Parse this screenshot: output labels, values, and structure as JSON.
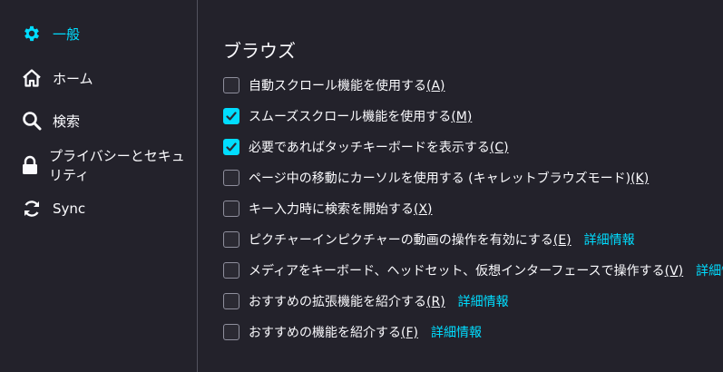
{
  "sidebar": {
    "items": [
      {
        "label": "一般",
        "icon": "gear-icon",
        "selected": true
      },
      {
        "label": "ホーム",
        "icon": "home-icon"
      },
      {
        "label": "検索",
        "icon": "search-icon"
      },
      {
        "label": "プライバシーとセキュリティ",
        "icon": "lock-icon"
      },
      {
        "label": "Sync",
        "icon": "sync-icon"
      }
    ]
  },
  "main": {
    "section_title": "ブラウズ",
    "options": [
      {
        "text": "自動スクロール機能を使用する",
        "access": "(A)",
        "checked": false
      },
      {
        "text": "スムーズスクロール機能を使用する",
        "access": "(M)",
        "checked": true
      },
      {
        "text": "必要であればタッチキーボードを表示する",
        "access": "(C)",
        "checked": true
      },
      {
        "text": "ページ中の移動にカーソルを使用する (キャレットブラウズモード)",
        "access": "(K)",
        "checked": false
      },
      {
        "text": "キー入力時に検索を開始する",
        "access": "(X)",
        "checked": false
      },
      {
        "text": "ピクチャーインピクチャーの動画の操作を有効にする",
        "access": "(E)",
        "checked": false,
        "link": "詳細情報"
      },
      {
        "text": "メディアをキーボード、ヘッドセット、仮想インターフェースで操作する",
        "access": "(V)",
        "checked": false,
        "link": "詳細情報"
      },
      {
        "text": "おすすめの拡張機能を紹介する",
        "access": "(R)",
        "checked": false,
        "link": "詳細情報"
      },
      {
        "text": "おすすめの機能を紹介する",
        "access": "(F)",
        "checked": false,
        "link": "詳細情報"
      }
    ]
  },
  "colors": {
    "accent": "#00ddff",
    "background": "#23222b"
  }
}
